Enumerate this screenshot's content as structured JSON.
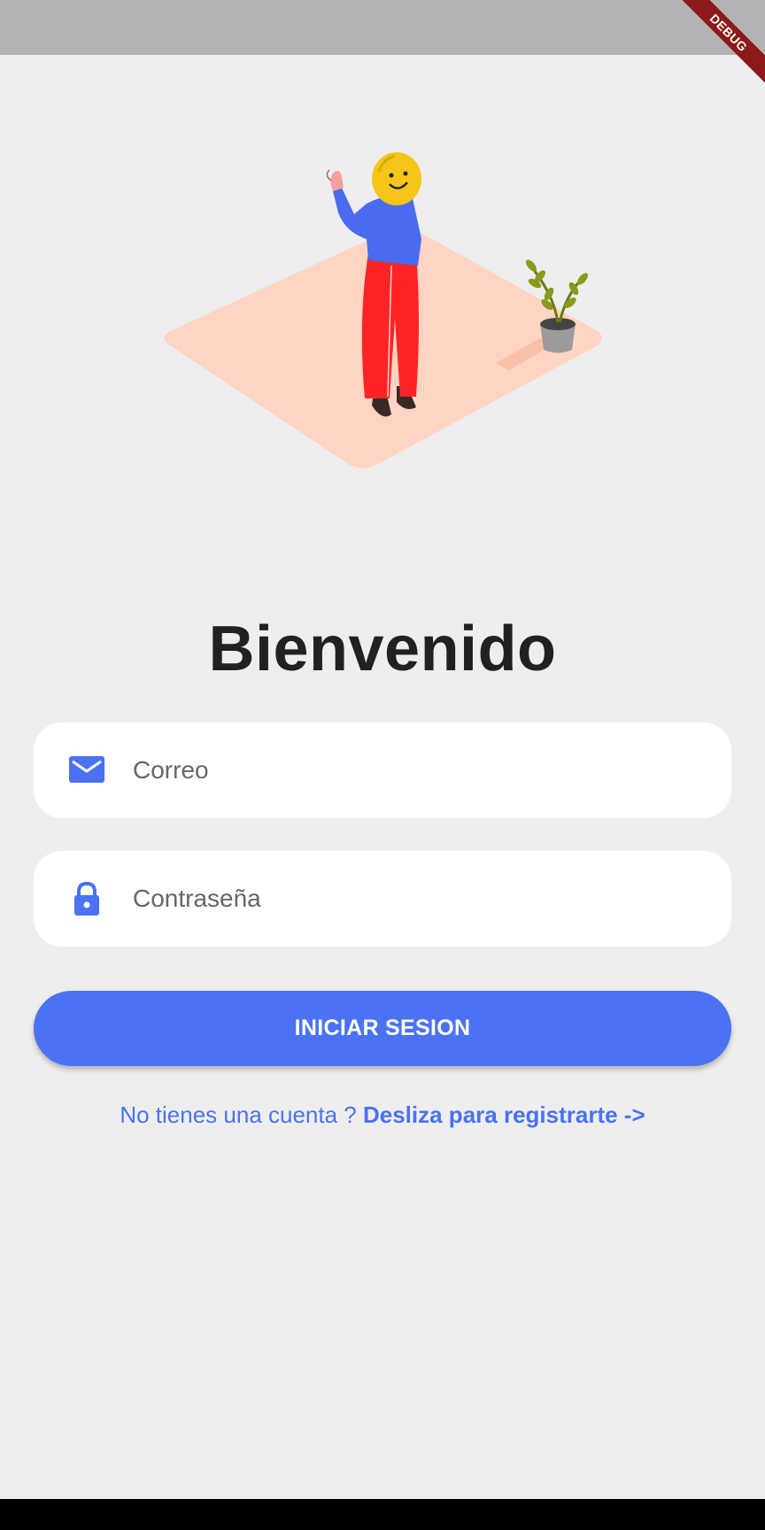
{
  "status_bar": {
    "debug_label": "DEBUG"
  },
  "illustration": {
    "icon": "person-waving-illustration"
  },
  "title": "Bienvenido",
  "form": {
    "email": {
      "placeholder": "Correo",
      "icon": "mail-icon"
    },
    "password": {
      "placeholder": "Contraseña",
      "icon": "lock-icon"
    },
    "submit_label": "INICIAR SESION"
  },
  "register": {
    "prompt": "No tienes una cuenta ? ",
    "link": "Desliza para registrarte ->"
  },
  "colors": {
    "accent": "#4a72f2",
    "background": "#eeeeef",
    "floor": "#ffd4c2",
    "shirt": "#4a6cf0",
    "pants": "#ff2424",
    "head": "#f5c518"
  }
}
